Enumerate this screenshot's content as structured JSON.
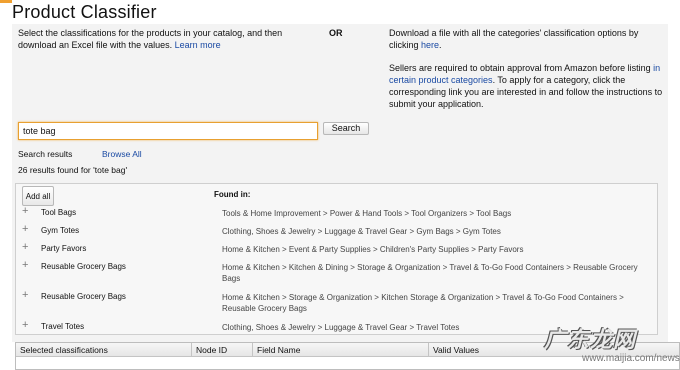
{
  "page": {
    "title": "Product Classifier"
  },
  "intro": {
    "left_text": "Select the classifications for the products in your catalog, and then download an Excel file with the values.",
    "learn_more": "Learn more",
    "or_label": "OR",
    "download_text": "Download a file with all the categories' classification options by clicking",
    "download_link": "here",
    "approval_text_1": "Sellers are required to obtain approval from Amazon before listing",
    "approval_link": "in certain product categories",
    "approval_text_2": ". To apply for a category, click the corresponding link you are interested in and follow the instructions to submit your application."
  },
  "search": {
    "value": "tote bag",
    "button_label": "Search"
  },
  "results": {
    "label": "Search results",
    "browse_all": "Browse All",
    "count_text": "26 results found for 'tote bag'",
    "add_all_label": "Add all",
    "found_in_header": "Found in:",
    "items": [
      {
        "name": "Tool Bags",
        "path": "Tools & Home Improvement > Power & Hand Tools > Tool Organizers > Tool Bags"
      },
      {
        "name": "Gym Totes",
        "path": "Clothing, Shoes & Jewelry > Luggage & Travel Gear > Gym Bags > Gym Totes"
      },
      {
        "name": "Party Favors",
        "path": "Home & Kitchen > Event & Party Supplies > Children's Party Supplies > Party Favors"
      },
      {
        "name": "Reusable Grocery Bags",
        "path": "Home & Kitchen > Kitchen & Dining > Storage & Organization > Travel & To-Go Food Containers > Reusable Grocery Bags"
      },
      {
        "name": "Reusable Grocery Bags",
        "path": "Home & Kitchen > Storage & Organization > Kitchen Storage & Organization > Travel & To-Go Food Containers > Reusable Grocery Bags"
      },
      {
        "name": "Travel Totes",
        "path": "Clothing, Shoes & Jewelry > Luggage & Travel Gear > Travel Totes"
      }
    ]
  },
  "selected_table": {
    "columns": [
      "Selected classifications",
      "Node ID",
      "Field Name",
      "Valid Values"
    ]
  },
  "watermark": {
    "text": "广东龙网",
    "url": "www.maijia.com/news"
  },
  "icons": {
    "expand": "plus-icon"
  },
  "colors": {
    "link": "#1a4aa3",
    "input_focus": "#e8a030"
  }
}
